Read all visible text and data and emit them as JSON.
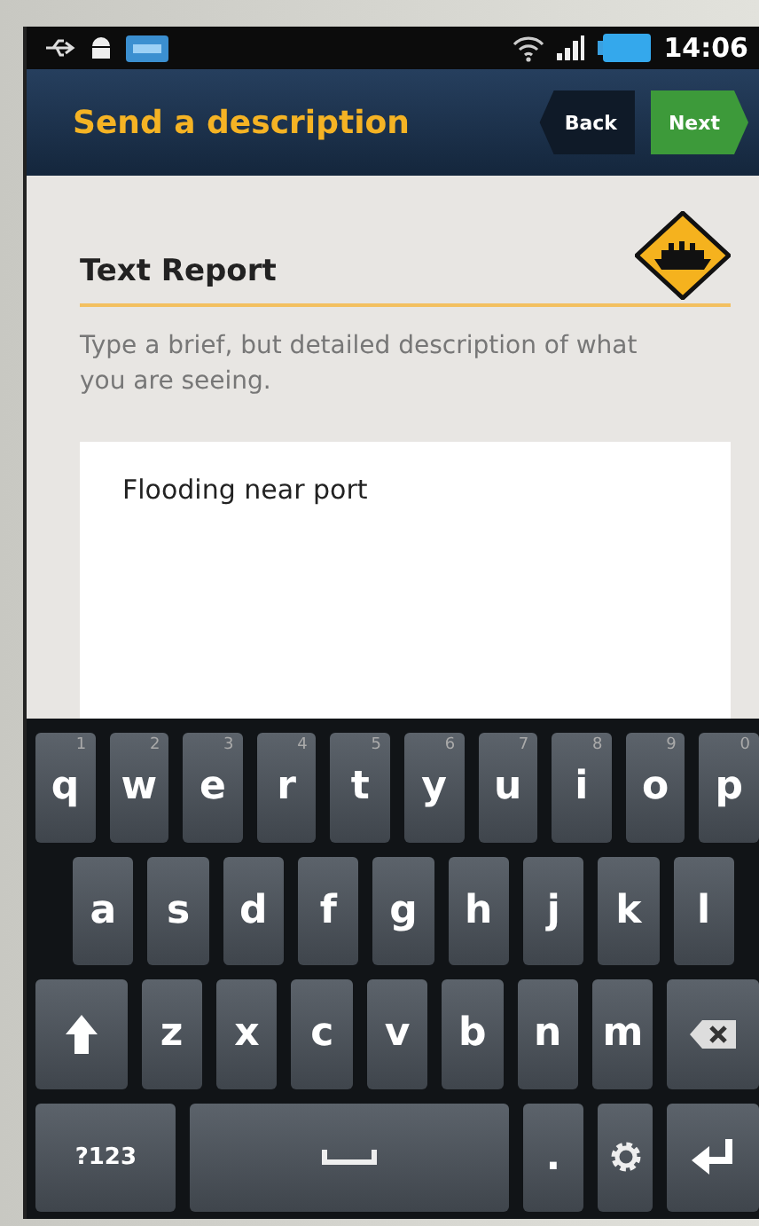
{
  "status_bar": {
    "time": "14:06"
  },
  "header": {
    "title": "Send a description",
    "buttons": [
      {
        "label": "Back",
        "kind": "back"
      },
      {
        "label": "Next",
        "kind": "next"
      }
    ]
  },
  "section": {
    "title": "Text Report",
    "instructions": "Type a brief, but detailed description of what you are seeing."
  },
  "text_field": {
    "value": "Flooding near port"
  },
  "keyboard": {
    "rows": [
      {
        "keys": [
          {
            "kind": "letter",
            "label": "q",
            "hint": "1"
          },
          {
            "kind": "letter",
            "label": "w",
            "hint": "2"
          },
          {
            "kind": "letter",
            "label": "e",
            "hint": "3"
          },
          {
            "kind": "letter",
            "label": "r",
            "hint": "4"
          },
          {
            "kind": "letter",
            "label": "t",
            "hint": "5"
          },
          {
            "kind": "letter",
            "label": "y",
            "hint": "6"
          },
          {
            "kind": "letter",
            "label": "u",
            "hint": "7"
          },
          {
            "kind": "letter",
            "label": "i",
            "hint": "8"
          },
          {
            "kind": "letter",
            "label": "o",
            "hint": "9"
          },
          {
            "kind": "letter",
            "label": "p",
            "hint": "0"
          }
        ]
      },
      {
        "keys": [
          {
            "kind": "letter",
            "label": "a"
          },
          {
            "kind": "letter",
            "label": "s"
          },
          {
            "kind": "letter",
            "label": "d"
          },
          {
            "kind": "letter",
            "label": "f"
          },
          {
            "kind": "letter",
            "label": "g"
          },
          {
            "kind": "letter",
            "label": "h"
          },
          {
            "kind": "letter",
            "label": "j"
          },
          {
            "kind": "letter",
            "label": "k"
          },
          {
            "kind": "letter",
            "label": "l"
          }
        ]
      },
      {
        "keys": [
          {
            "kind": "shift"
          },
          {
            "kind": "letter",
            "label": "z"
          },
          {
            "kind": "letter",
            "label": "x"
          },
          {
            "kind": "letter",
            "label": "c"
          },
          {
            "kind": "letter",
            "label": "v"
          },
          {
            "kind": "letter",
            "label": "b"
          },
          {
            "kind": "letter",
            "label": "n"
          },
          {
            "kind": "letter",
            "label": "m"
          },
          {
            "kind": "backspace"
          }
        ]
      },
      {
        "keys": [
          {
            "kind": "symbols",
            "label": "?123"
          },
          {
            "kind": "space"
          },
          {
            "kind": "period",
            "label": "."
          },
          {
            "kind": "settings"
          },
          {
            "kind": "enter"
          }
        ]
      }
    ]
  }
}
